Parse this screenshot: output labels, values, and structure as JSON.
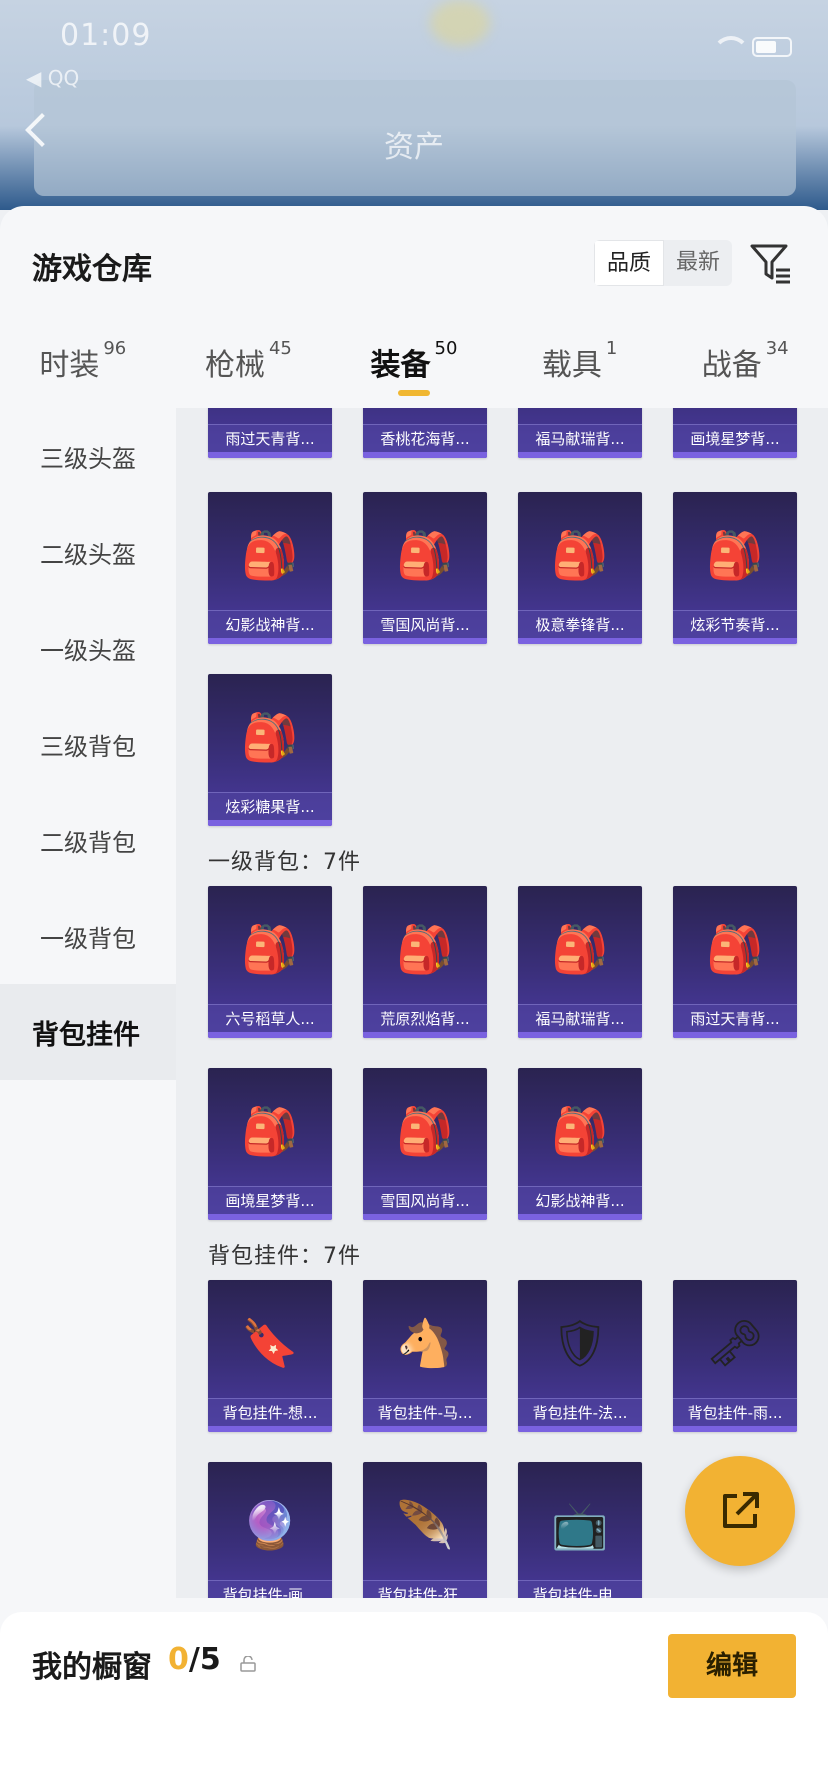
{
  "status_bar": {
    "time": "01:09",
    "back_app": "◀ QQ"
  },
  "nav": {
    "title": "资产"
  },
  "sheet": {
    "title": "游戏仓库",
    "sort": {
      "quality": "品质",
      "newest": "最新"
    }
  },
  "tabs": [
    {
      "label": "时装",
      "count": "96"
    },
    {
      "label": "枪械",
      "count": "45"
    },
    {
      "label": "装备",
      "count": "50"
    },
    {
      "label": "载具",
      "count": "1"
    },
    {
      "label": "战备",
      "count": "34"
    }
  ],
  "sidebar": {
    "items": [
      {
        "label": "三级头盔"
      },
      {
        "label": "二级头盔"
      },
      {
        "label": "一级头盔"
      },
      {
        "label": "三级背包"
      },
      {
        "label": "二级背包"
      },
      {
        "label": "一级背包"
      },
      {
        "label": "背包挂件"
      }
    ]
  },
  "content": {
    "top_partial_row": [
      "雨过天青背...",
      "香桃花海背...",
      "福马献瑞背...",
      "画境星梦背..."
    ],
    "level2_rows": [
      [
        "幻影战神背...",
        "雪国风尚背...",
        "极意拳锋背...",
        "炫彩节奏背..."
      ],
      [
        "炫彩糖果背..."
      ]
    ],
    "level1_title": "一级背包：7件",
    "level1_rows": [
      [
        "六号稻草人...",
        "荒原烈焰背...",
        "福马献瑞背...",
        "雨过天青背..."
      ],
      [
        "画境星梦背...",
        "雪国风尚背...",
        "幻影战神背..."
      ]
    ],
    "pendant_title": "背包挂件：7件",
    "pendant_rows": [
      [
        "背包挂件-想...",
        "背包挂件-马...",
        "背包挂件-法...",
        "背包挂件-雨..."
      ],
      [
        "背包挂件-画...",
        "背包挂件-狂...",
        "背包挂件-电..."
      ]
    ]
  },
  "bottom": {
    "label": "我的橱窗",
    "used": "0",
    "total": "/5",
    "edit": "编辑"
  },
  "colors": {
    "accent": "#f2b233",
    "card_top": "#2a2350",
    "card_bottom": "#4b3ba1"
  },
  "icons": [
    "filter-icon",
    "share-icon",
    "lock-icon",
    "back-arrow-icon",
    "wifi-icon",
    "battery-icon"
  ]
}
